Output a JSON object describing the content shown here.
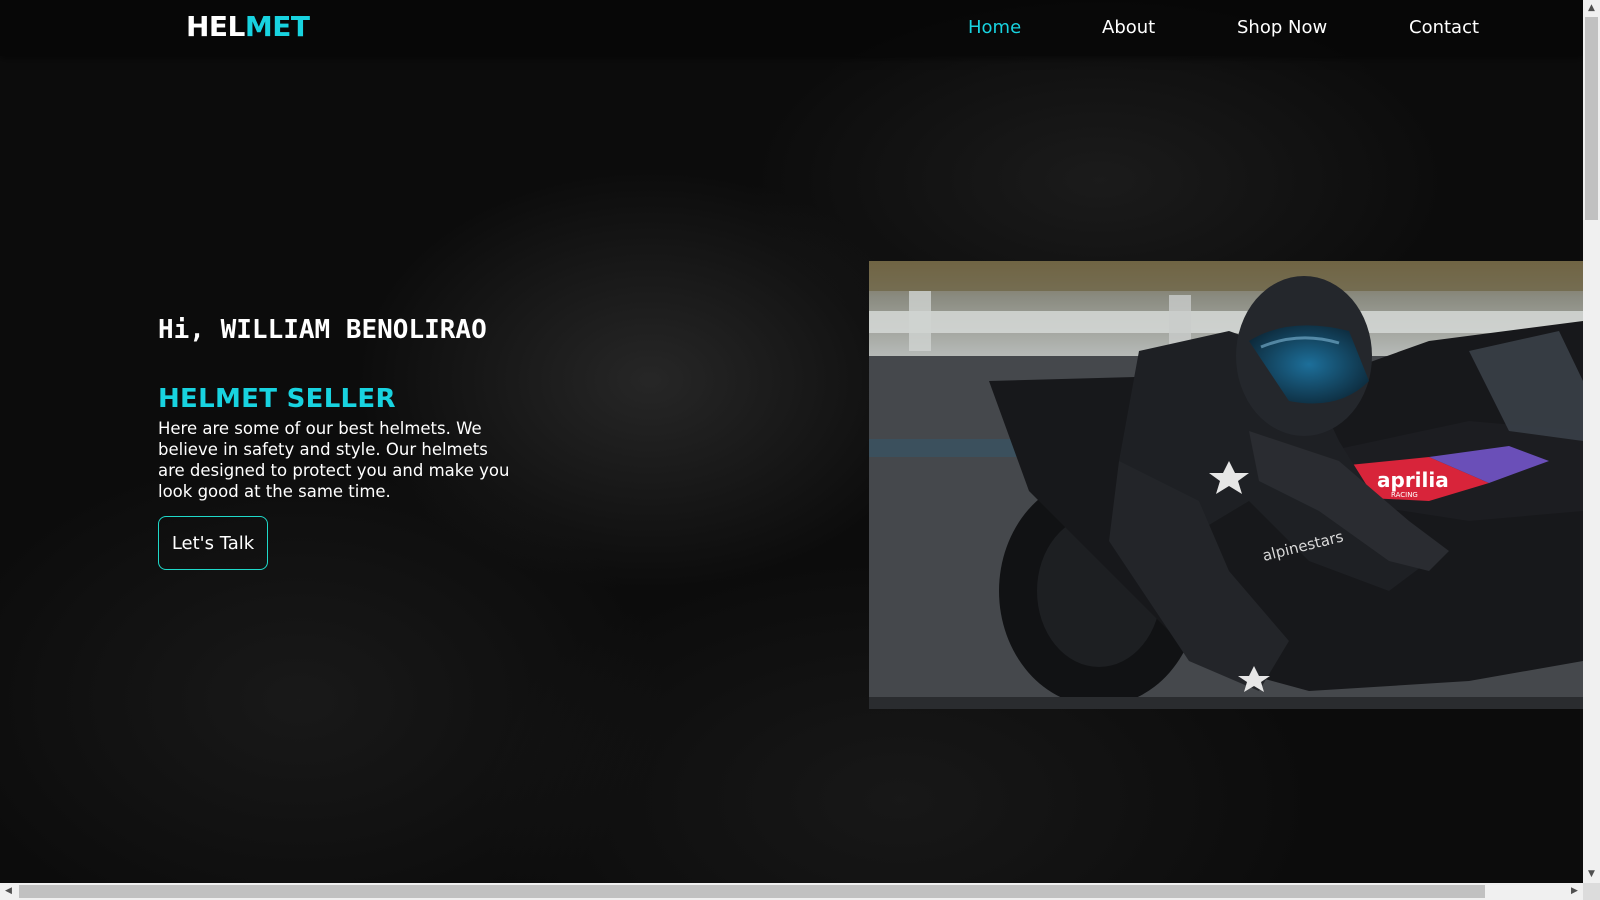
{
  "header": {
    "logo_part1": "HEL",
    "logo_part2": "MET",
    "nav": [
      {
        "label": "Home",
        "active": true
      },
      {
        "label": "About",
        "active": false
      },
      {
        "label": "Shop Now",
        "active": false
      },
      {
        "label": "Contact",
        "active": false
      }
    ]
  },
  "hero": {
    "greeting": "Hi, WILLIAM BENOLIRAO",
    "role": "HELMET SELLER",
    "description": "Here are some of our best helmets. We believe in safety and style. Our helmets are designed to protect you and make you look good at the same time.",
    "cta_label": "Let's Talk",
    "image_text": {
      "brand": "aprilia",
      "brand_sub": "RACING",
      "suit": "alpinestars"
    }
  },
  "colors": {
    "accent": "#18d3e0",
    "button_border": "#1fd9c9",
    "background": "#0c0c0c"
  },
  "icons": {
    "scroll_up": "scroll-up-arrow-icon",
    "scroll_down": "scroll-down-arrow-icon",
    "scroll_left": "scroll-left-arrow-icon",
    "scroll_right": "scroll-right-arrow-icon"
  }
}
